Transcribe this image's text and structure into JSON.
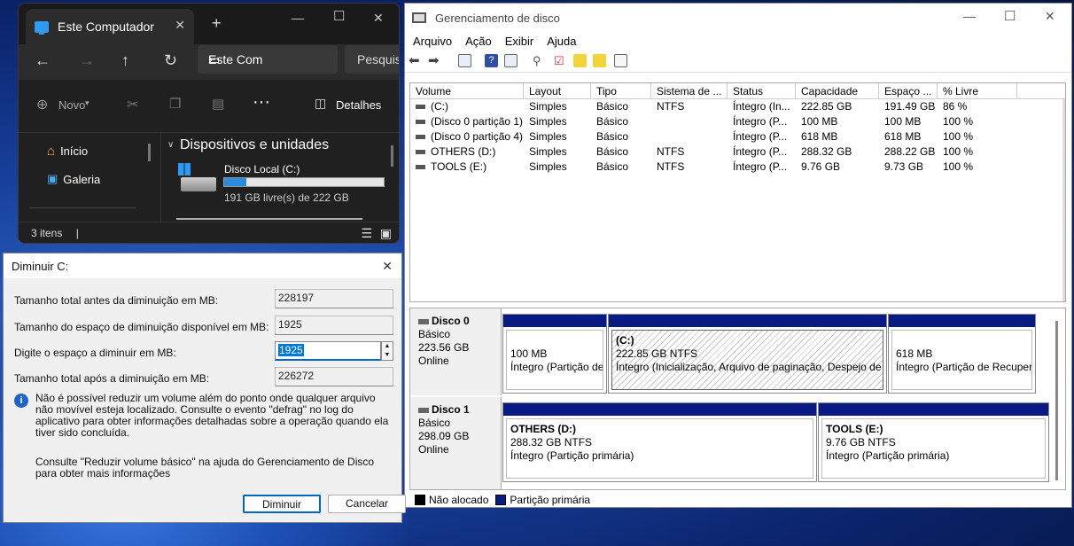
{
  "explorer": {
    "tab_title": "Este Computador",
    "address": "Este Com",
    "search": "Pesquis",
    "toolbar": {
      "new_label": "Novo",
      "details_label": "Detalhes"
    },
    "sidebar": [
      "Início",
      "Galeria"
    ],
    "section_title": "Dispositivos e unidades",
    "drive": {
      "name": "Disco Local (C:)",
      "free_text": "191 GB livre(s) de 222 GB",
      "used_fraction": 0.14
    },
    "status": "3 itens"
  },
  "dialog": {
    "title": "Diminuir C:",
    "rows": [
      {
        "label": "Tamanho total antes da diminuição em MB:",
        "value": "228197"
      },
      {
        "label": "Tamanho do espaço de diminuição disponível em MB:",
        "value": "1925"
      },
      {
        "label": "Digite o espaço a diminuir em MB:",
        "value": "1925"
      },
      {
        "label": "Tamanho total após a diminuição em MB:",
        "value": "226272"
      }
    ],
    "info_text": "Não é possível reduzir um volume além do ponto onde qualquer arquivo não movível esteja localizado. Consulte o evento \"defrag\" no log do aplicativo para obter informações detalhadas sobre a operação quando ela tiver sido concluída.",
    "help_text": "Consulte \"Reduzir volume básico\" na ajuda do Gerenciamento de Disco para obter mais informações",
    "ok_label": "Diminuir",
    "cancel_label": "Cancelar"
  },
  "diskmgmt": {
    "title": "Gerenciamento de disco",
    "menu": [
      "Arquivo",
      "Ação",
      "Exibir",
      "Ajuda"
    ],
    "columns": [
      "Volume",
      "Layout",
      "Tipo",
      "Sistema de ...",
      "Status",
      "Capacidade",
      "Espaço ...",
      "% Livre"
    ],
    "rows": [
      [
        "(C:)",
        "Simples",
        "Básico",
        "NTFS",
        "Íntegro (In...",
        "222.85 GB",
        "191.49 GB",
        "86 %"
      ],
      [
        "(Disco 0 partição 1)",
        "Simples",
        "Básico",
        "",
        "Íntegro (P...",
        "100 MB",
        "100 MB",
        "100 %"
      ],
      [
        "(Disco 0 partição 4)",
        "Simples",
        "Básico",
        "",
        "Íntegro (P...",
        "618 MB",
        "618 MB",
        "100 %"
      ],
      [
        "OTHERS (D:)",
        "Simples",
        "Básico",
        "NTFS",
        "Íntegro (P...",
        "288.32 GB",
        "288.22 GB",
        "100 %"
      ],
      [
        "TOOLS (E:)",
        "Simples",
        "Básico",
        "NTFS",
        "Íntegro (P...",
        "9.76 GB",
        "9.73 GB",
        "100 %"
      ]
    ],
    "disks": [
      {
        "name": "Disco 0",
        "type": "Básico",
        "size": "223.56 GB",
        "state": "Online",
        "partitions": [
          {
            "name": "",
            "size": "100 MB",
            "status": "Íntegro (Partição de"
          },
          {
            "name": "(C:)",
            "size": "222.85 GB NTFS",
            "status": "Íntegro (Inicialização, Arquivo de paginação, Despejo de r"
          },
          {
            "name": "",
            "size": "618 MB",
            "status": "Íntegro (Partição de Recuper"
          }
        ]
      },
      {
        "name": "Disco 1",
        "type": "Básico",
        "size": "298.09 GB",
        "state": "Online",
        "partitions": [
          {
            "name": "OTHERS  (D:)",
            "size": "288.32 GB NTFS",
            "status": "Íntegro (Partição primária)"
          },
          {
            "name": "TOOLS  (E:)",
            "size": "9.76 GB NTFS",
            "status": "Íntegro (Partição primária)"
          }
        ]
      }
    ],
    "legend": [
      {
        "label": "Não alocado",
        "color": "#000000"
      },
      {
        "label": "Partição primária",
        "color": "#0a1a84"
      }
    ]
  }
}
